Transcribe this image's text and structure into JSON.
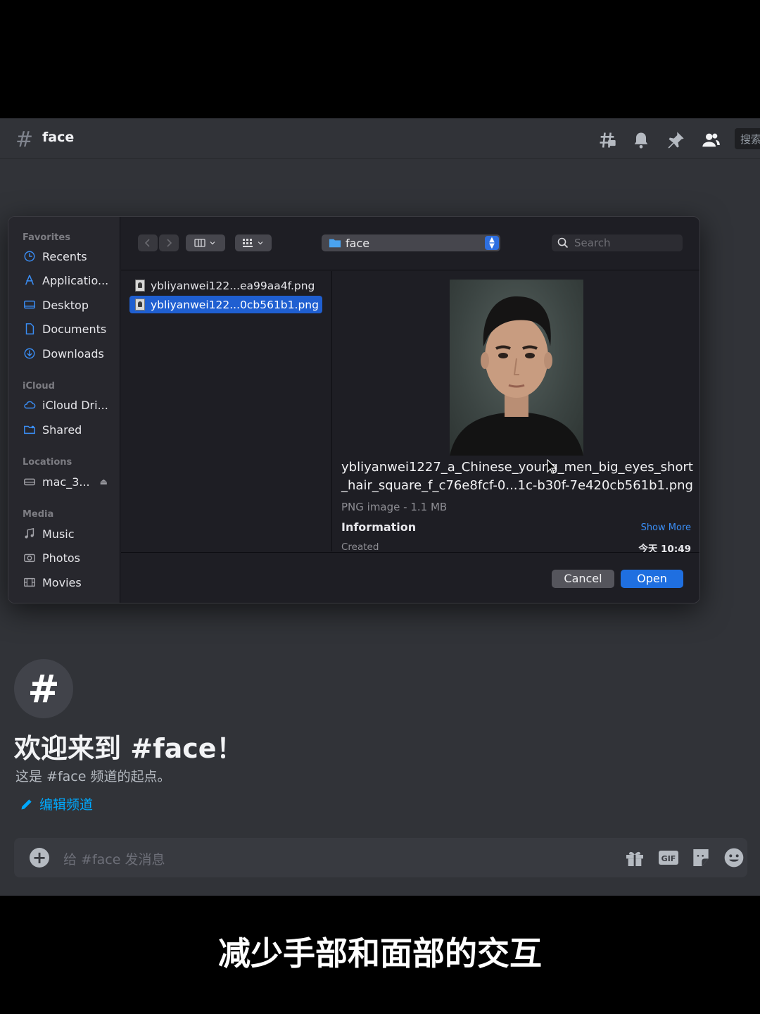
{
  "header": {
    "channel_name": "face",
    "search_label": "搜索"
  },
  "welcome": {
    "title": "欢迎来到 #face！",
    "subtitle": "这是 #face 频道的起点。",
    "edit_label": "编辑频道"
  },
  "message_bar": {
    "placeholder": "给 #face 发消息",
    "gif_label": "GIF"
  },
  "dialog": {
    "sidebar": {
      "favorites_label": "Favorites",
      "favorites": [
        "Recents",
        "Applicatio...",
        "Desktop",
        "Documents",
        "Downloads"
      ],
      "icloud_label": "iCloud",
      "icloud": [
        "iCloud Dri...",
        "Shared"
      ],
      "locations_label": "Locations",
      "locations": [
        "mac_3..."
      ],
      "media_label": "Media",
      "media": [
        "Music",
        "Photos",
        "Movies"
      ]
    },
    "folder_name": "face",
    "search_placeholder": "Search",
    "files": [
      "ybliyanwei122...ea99aa4f.png",
      "ybliyanwei122...0cb561b1.png"
    ],
    "selected_index": 1,
    "preview": {
      "file_name": "ybliyanwei1227_a_Chinese_young_men_big_eyes_short_hair_square_f_c76e8fcf-0...1c-b30f-7e420cb561b1.png",
      "meta": "PNG image - 1.1 MB",
      "info_label": "Information",
      "show_more": "Show More",
      "created_label": "Created",
      "created_value": "今天 10:49"
    },
    "cancel_label": "Cancel",
    "open_label": "Open"
  },
  "caption": "减少手部和面部的交互",
  "colors": {
    "discord_bg": "#313338",
    "accent_blue": "#1f6fe0",
    "link_blue": "#00a8fc"
  }
}
